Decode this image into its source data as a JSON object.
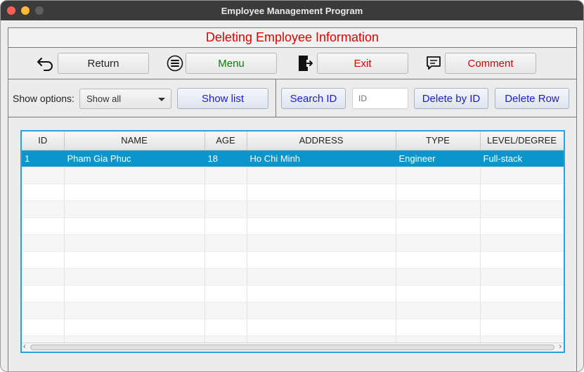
{
  "window": {
    "title": "Employee Management Program"
  },
  "header": {
    "title": "Deleting Employee Information"
  },
  "toolbar": {
    "return_label": "Return",
    "menu_label": "Menu",
    "exit_label": "Exit",
    "comment_label": "Comment",
    "return_icon": "return-arrow-icon",
    "menu_icon": "list-icon",
    "exit_icon": "door-exit-icon",
    "comment_icon": "speech-bubble-icon"
  },
  "options": {
    "label": "Show options:",
    "selected": "Show all",
    "show_list_label": "Show list",
    "search_id_label": "Search ID",
    "id_placeholder": "ID",
    "delete_by_id_label": "Delete by ID",
    "delete_row_label": "Delete Row"
  },
  "table": {
    "columns": [
      "ID",
      "NAME",
      "AGE",
      "ADDRESS",
      "TYPE",
      "LEVEL/DEGREE"
    ],
    "rows": [
      {
        "id": "1",
        "name": "Pham Gia Phuc",
        "age": "18",
        "address": "Ho Chi Minh",
        "type": "Engineer",
        "level": "Full-stack"
      }
    ],
    "selected_row_index": 0
  },
  "colors": {
    "header_text": "#e00000",
    "menu_text": "#0a7a0a",
    "exit_text": "#d40000",
    "blue_button_text": "#1c1ccf",
    "selection": "#0a96cc",
    "table_border": "#29a3e0"
  }
}
